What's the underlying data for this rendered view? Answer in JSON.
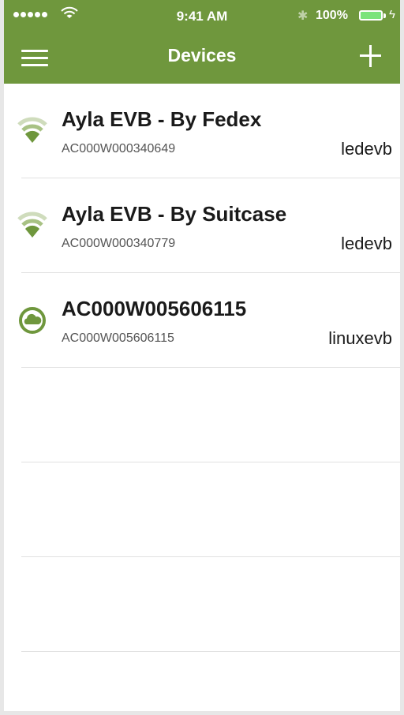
{
  "status_bar": {
    "time": "9:41 AM",
    "battery": "100%"
  },
  "nav": {
    "title": "Devices"
  },
  "devices": [
    {
      "name": "Ayla EVB - By Fedex",
      "dsn": "AC000W000340649",
      "model": "ledevb",
      "icon": "wifi-signal-icon"
    },
    {
      "name": "Ayla EVB - By Suitcase",
      "dsn": "AC000W000340779",
      "model": "ledevb",
      "icon": "wifi-signal-icon"
    },
    {
      "name": "AC000W005606115",
      "dsn": "AC000W005606115",
      "model": "linuxevb",
      "icon": "cloud-icon"
    }
  ],
  "colors": {
    "accent": "#6f973d",
    "nav_background": "#6f973d"
  }
}
